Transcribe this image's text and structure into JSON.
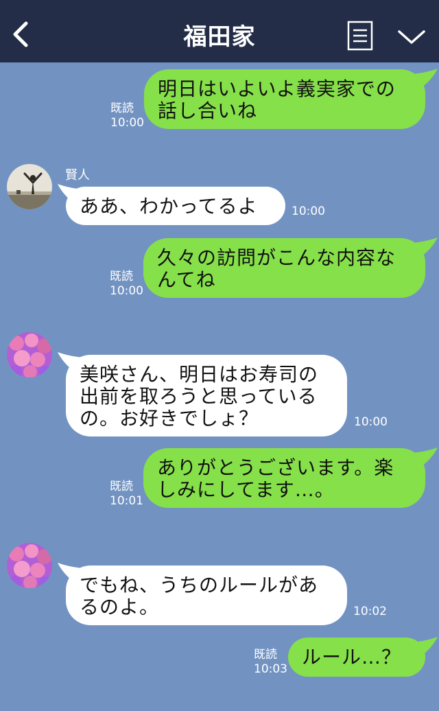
{
  "header": {
    "title": "福田家",
    "back_icon": "chevron-left-icon",
    "menu_icon": "list-icon",
    "more_icon": "chevron-down-icon"
  },
  "colors": {
    "header_bg": "#232d47",
    "chat_bg": "#7293c2",
    "my_bubble": "#86e04a",
    "their_bubble": "#ffffff"
  },
  "messages": [
    {
      "side": "me",
      "text": "明日はいよいよ義実家での\n話し合いね",
      "read": "既読",
      "time": "10:00"
    },
    {
      "side": "them",
      "sender": "賢人",
      "avatar": "man-landscape-avatar",
      "text": "ああ、わかってるよ",
      "time": "10:00"
    },
    {
      "side": "me",
      "text": "久々の訪問がこんな内容な\nんてね",
      "read": "既読",
      "time": "10:00"
    },
    {
      "side": "them",
      "avatar": "flower-avatar",
      "text": "美咲さん、明日はお寿司の\n出前を取ろうと思っている\nの。お好きでしょ？",
      "time": "10:00"
    },
    {
      "side": "me",
      "text": "ありがとうございます。楽\nしみにしてます…。",
      "read": "既読",
      "time": "10:01"
    },
    {
      "side": "them",
      "avatar": "flower-avatar",
      "text": "でもね、うちのルールがあ\nるのよ。",
      "time": "10:02"
    },
    {
      "side": "me",
      "text": "ルール…？",
      "read": "既読",
      "time": "10:03"
    }
  ]
}
